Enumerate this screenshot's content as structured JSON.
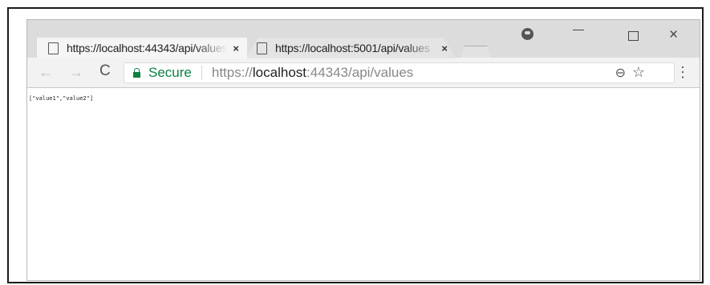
{
  "tabs": [
    {
      "title": "https://localhost:44343/api/values",
      "close": "×"
    },
    {
      "title": "https://localhost:5001/api/values",
      "close": "×"
    }
  ],
  "window_controls": {
    "minimize": "–",
    "maximize": "☐",
    "close": "×"
  },
  "toolbar": {
    "back": "←",
    "forward": "→",
    "reload": "C",
    "secure_label": "Secure",
    "url_scheme": "https://",
    "url_host": "localhost",
    "url_rest": ":44343/api/values",
    "zoom": "⊖",
    "star": "☆",
    "menu": "⋮"
  },
  "page": {
    "body_text": "[\"value1\",\"value2\"]"
  },
  "colors": {
    "secure_green": "#0b8043",
    "chrome_frame": "#dcdcdc"
  }
}
